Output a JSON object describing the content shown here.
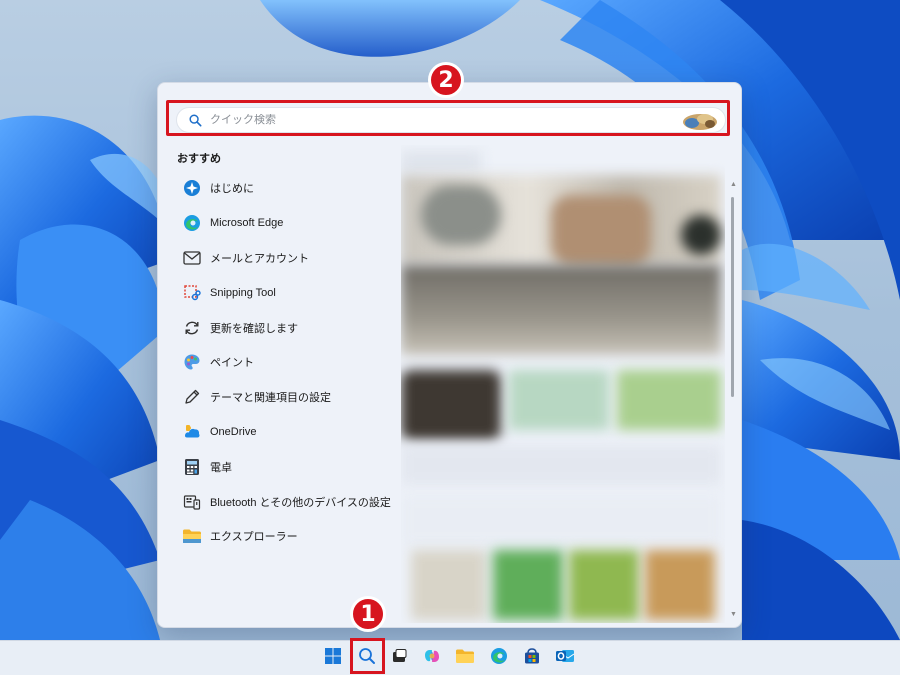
{
  "search": {
    "placeholder": "クイック検索"
  },
  "recommended": {
    "heading": "おすすめ",
    "items": [
      {
        "label": "はじめに",
        "icon": "get-started-icon"
      },
      {
        "label": "Microsoft Edge",
        "icon": "edge-icon"
      },
      {
        "label": "メールとアカウント",
        "icon": "mail-icon"
      },
      {
        "label": "Snipping Tool",
        "icon": "snipping-tool-icon"
      },
      {
        "label": "更新を確認します",
        "icon": "refresh-icon"
      },
      {
        "label": "ペイント",
        "icon": "paint-palette-icon"
      },
      {
        "label": "テーマと関連項目の設定",
        "icon": "pen-icon"
      },
      {
        "label": "OneDrive",
        "icon": "onedrive-icon"
      },
      {
        "label": "電卓",
        "icon": "calculator-icon"
      },
      {
        "label": "Bluetooth とその他のデバイスの設定",
        "icon": "devices-icon"
      },
      {
        "label": "エクスプローラー",
        "icon": "folder-icon"
      }
    ]
  },
  "annotations": {
    "badge_1": "1",
    "badge_2": "2",
    "highlight_color": "#d7151f"
  },
  "taskbar": {
    "items": [
      "windows-start-icon",
      "search-icon",
      "task-view-icon",
      "copilot-icon",
      "file-explorer-icon",
      "edge-icon",
      "store-icon",
      "outlook-icon"
    ]
  },
  "colors": {
    "panel_bg": "#eef2f9",
    "taskbar_bg": "#e8eef6",
    "wallpaper_bloom": "#1e6fe0"
  }
}
